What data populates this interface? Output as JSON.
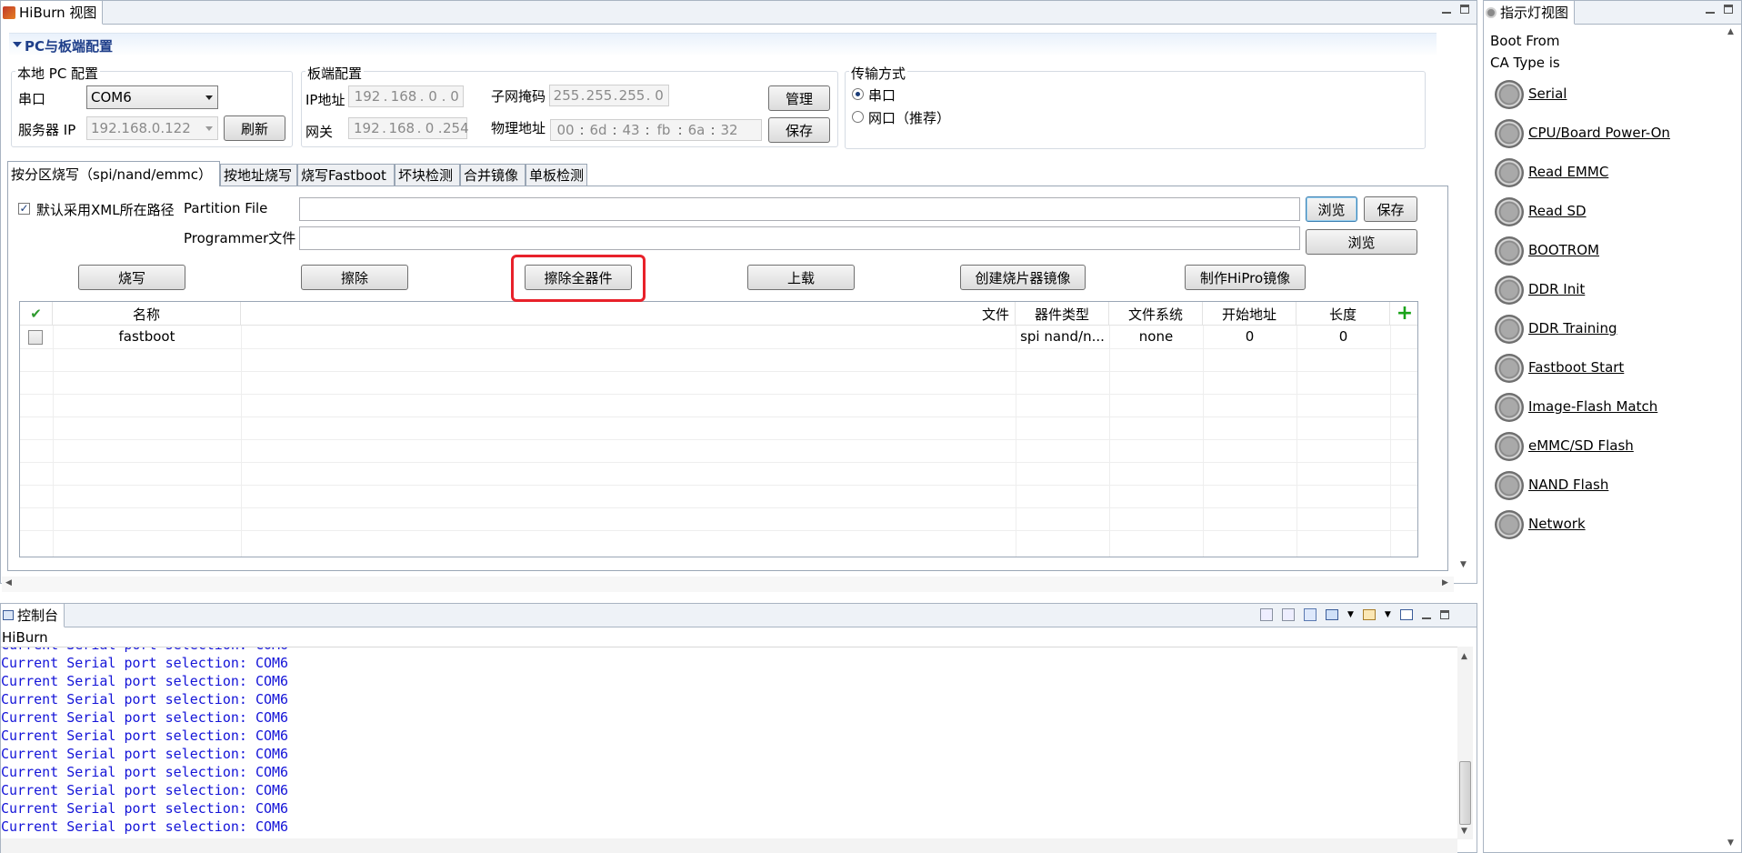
{
  "hiburn_view": {
    "title": "HiBurn 视图",
    "section_title": "PC与板端配置",
    "local_pc": {
      "group_title": "本地 PC 配置",
      "serial_label": "串口",
      "serial_value": "COM6",
      "server_ip_label": "服务器 IP",
      "server_ip_value": "192.168.0.122",
      "refresh_label": "刷新"
    },
    "board": {
      "group_title": "板端配置",
      "ip_label": "IP地址",
      "ip_parts": [
        "192",
        "168",
        "0",
        "0"
      ],
      "gateway_label": "网关",
      "gateway_parts": [
        "192",
        "168",
        "0",
        "254"
      ],
      "subnet_label": "子网掩码",
      "subnet_parts": [
        "255",
        "255",
        "255",
        "0"
      ],
      "mac_label": "物理地址",
      "mac_parts": [
        "00",
        "6d",
        "43",
        "fb",
        "6a",
        "32"
      ],
      "manage_label": "管理",
      "save_label": "保存"
    },
    "transfer": {
      "group_title": "传输方式",
      "serial_option": "串口",
      "network_option": "网口（推荐）",
      "selected": "串口"
    },
    "tabs": [
      {
        "label": "按分区烧写（spi/nand/emmc）",
        "active": true
      },
      {
        "label": "按地址烧写",
        "active": false
      },
      {
        "label": "烧写Fastboot",
        "active": false
      },
      {
        "label": "坏块检测",
        "active": false
      },
      {
        "label": "合并镜像",
        "active": false
      },
      {
        "label": "单板检测",
        "active": false
      }
    ],
    "partition": {
      "use_xml_path_label": "默认采用XML所在路径",
      "use_xml_path_checked": true,
      "partition_file_label": "Partition File",
      "partition_file_value": "",
      "programmer_file_label": "Programmer文件",
      "programmer_file_value": "",
      "browse_label": "浏览",
      "save_label": "保存",
      "browse2_label": "浏览"
    },
    "actions": {
      "burn": "烧写",
      "erase": "擦除",
      "erase_all": "擦除全器件",
      "upload": "上载",
      "create_image": "创建烧片器镜像",
      "make_hipro": "制作HiPro镜像"
    },
    "table": {
      "columns": [
        "名称",
        "文件",
        "器件类型",
        "文件系统",
        "开始地址",
        "长度"
      ],
      "rows": [
        {
          "checked": false,
          "name": "fastboot",
          "file": "",
          "device_type": "spi nand/n...",
          "filesystem": "none",
          "start": "0",
          "length": "0"
        }
      ]
    }
  },
  "console_view": {
    "title": "控制台",
    "sub_title": "HiBurn",
    "partial_line": "Current Serial port selection: COM6",
    "lines": [
      "Current Serial port selection: COM6",
      "Current Serial port selection: COM6",
      "Current Serial port selection: COM6",
      "Current Serial port selection: COM6",
      "Current Serial port selection: COM6",
      "Current Serial port selection: COM6",
      "Current Serial port selection: COM6",
      "Current Serial port selection: COM6",
      "Current Serial port selection: COM6",
      "Current Serial port selection: COM6"
    ]
  },
  "indicator_view": {
    "title": "指示灯视图",
    "boot_from_label": "Boot From",
    "ca_type_label": "CA Type is",
    "items": [
      "Serial",
      "CPU/Board Power-On",
      "Read EMMC",
      "Read SD ",
      "BOOTROM",
      "DDR Init",
      "DDR Training",
      "Fastboot Start",
      "Image-Flash Match",
      "eMMC/SD Flash",
      "NAND Flash",
      "Network"
    ]
  },
  "colors": {
    "section_title": "#1f3f8a",
    "console_text": "#1414d8",
    "highlight": "#e8212a"
  }
}
